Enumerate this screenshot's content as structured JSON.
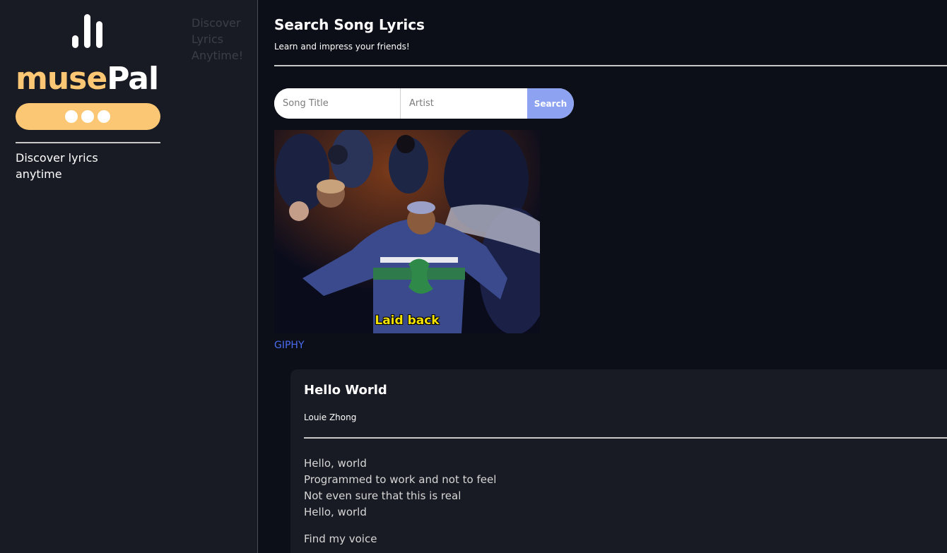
{
  "sidebar": {
    "brand_part1": "muse",
    "brand_part2": "Pal",
    "tagline": "Discover lyrics anytime",
    "colors": {
      "accent": "#fcc774",
      "background": "#181b23"
    }
  },
  "strip": {
    "text": "Discover Lyrics Anytime!"
  },
  "main": {
    "title": "Search Song Lyrics",
    "subtitle": "Learn and impress your friends!",
    "search": {
      "title_placeholder": "Song Title",
      "artist_placeholder": "Artist",
      "title_value": "",
      "artist_value": "",
      "button_label": "Search",
      "button_color": "#8da2f0"
    },
    "gif": {
      "caption": "Laid back",
      "link_label": "GIPHY"
    },
    "song": {
      "title": "Hello World",
      "artist": "Louie Zhong",
      "stanzas": [
        [
          "Hello, world",
          "Programmed to work and not to feel",
          "Not even sure that this is real",
          "Hello, world"
        ],
        [
          "Find my voice"
        ]
      ]
    }
  }
}
